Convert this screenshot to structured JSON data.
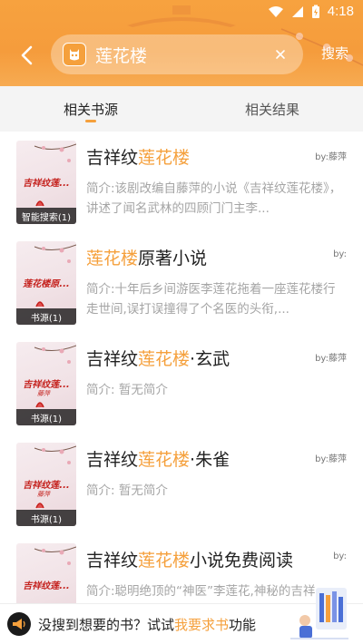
{
  "status_bar": {
    "time": "4:18"
  },
  "header": {
    "search_query": "莲花楼",
    "search_button": "搜索"
  },
  "tabs": [
    {
      "label": "相关书源",
      "active": true
    },
    {
      "label": "相关结果",
      "active": false
    }
  ],
  "books": [
    {
      "title_before": "吉祥纹",
      "title_highlight": "莲花楼",
      "title_after": "",
      "author": "by:藤萍",
      "desc": "简介:该剧改编自藤萍的小说《吉祥纹莲花楼》，讲述了闻名武林的四顾门门主李...",
      "cover_title": "吉祥纹莲...",
      "cover_author": "",
      "badge": "智能搜索(1)"
    },
    {
      "title_before": "",
      "title_highlight": "莲花楼",
      "title_after": "原著小说",
      "author": "by:",
      "desc": "简介:十年后乡间游医李莲花拖着一座莲花楼行走世间,误打误撞得了个名医的头衔,...",
      "cover_title": "莲花楼原...",
      "cover_author": "",
      "badge": "书源(1)"
    },
    {
      "title_before": "吉祥纹",
      "title_highlight": "莲花楼",
      "title_after": "·玄武",
      "author": "by:藤萍",
      "desc": "简介: 暂无简介",
      "cover_title": "吉祥纹莲...",
      "cover_author": "藤萍",
      "badge": "书源(1)"
    },
    {
      "title_before": "吉祥纹",
      "title_highlight": "莲花楼",
      "title_after": "·朱雀",
      "author": "by:藤萍",
      "desc": "简介: 暂无简介",
      "cover_title": "吉祥纹莲...",
      "cover_author": "藤萍",
      "badge": "书源(1)"
    },
    {
      "title_before": "吉祥纹",
      "title_highlight": "莲花楼",
      "title_after": "小说免费阅读",
      "author": "by:",
      "desc": "简介:聪明绝顶的“神医”李莲花,神秘的吉祥",
      "cover_title": "吉祥纹莲...",
      "cover_author": "",
      "badge": ""
    }
  ],
  "bottom_bar": {
    "text_before": "没搜到想要的书？试试",
    "link": "我要求书",
    "text_after": "功能"
  },
  "colors": {
    "accent": "#f5a03c",
    "cover_text": "#c4201c"
  },
  "icons": [
    "wifi-icon",
    "signal-icon",
    "battery-charging-icon",
    "back-icon",
    "app-icon",
    "clear-icon",
    "megaphone-icon"
  ]
}
